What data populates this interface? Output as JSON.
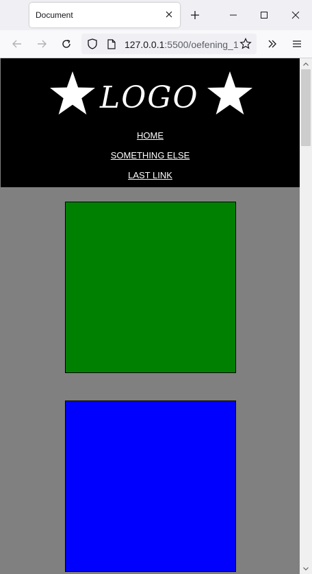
{
  "browser": {
    "tab_title": "Document",
    "url_host": "127.0.0.1",
    "url_path": ":5500/oefening_1"
  },
  "site": {
    "logo_text": "LOGO",
    "nav": [
      "HOME",
      "SOMETHING ELSE",
      "LAST LINK"
    ]
  },
  "colors": {
    "header_bg": "#000000",
    "page_bg": "#808080",
    "box_1": "#008000",
    "box_2": "#0000ff"
  }
}
